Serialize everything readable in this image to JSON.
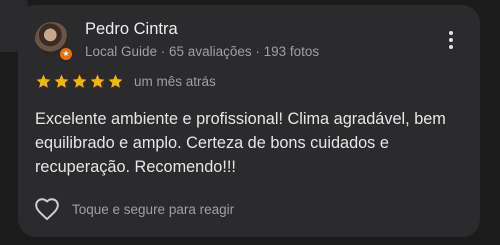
{
  "review": {
    "author_name": "Pedro Cintra",
    "author_meta": "Local Guide · 65 avaliações · 193 fotos",
    "rating": 5,
    "rating_max": 5,
    "date": "um mês atrás",
    "text": "Excelente ambiente e profissional! Clima agradável, bem equilibrado e amplo. Certeza de bons cuidados e recuperação. Recomendo!!!",
    "like_label": "Toque e segure para reagir"
  },
  "colors": {
    "background": "#1b1b1b",
    "card": "#2b2b2d",
    "star": "#f4b400",
    "badge": "#e8710a",
    "secondary_text": "#9aa0a6"
  },
  "icons": {
    "avatar": "avatar",
    "badge": "local-guide-badge-icon",
    "more": "more-vert-icon",
    "star": "star-icon",
    "like": "heart-outline-icon"
  }
}
